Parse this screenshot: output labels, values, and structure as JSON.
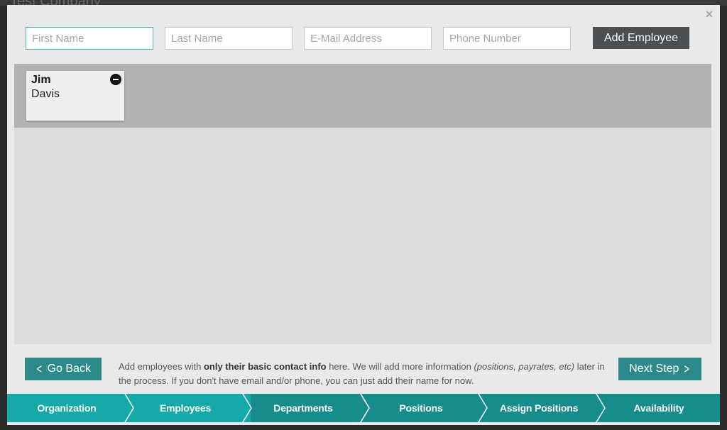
{
  "background": {
    "title": "Test Company"
  },
  "modal": {
    "close_label": "×"
  },
  "form": {
    "first_name_placeholder": "First Name",
    "last_name_placeholder": "Last Name",
    "email_placeholder": "E-Mail Address",
    "phone_placeholder": "Phone Number",
    "add_button_label": "Add Employee"
  },
  "employees": [
    {
      "first": "Jim",
      "last": "Davis"
    }
  ],
  "footer": {
    "back_label": "Go Back",
    "next_label": "Next Step",
    "help_pre": "Add employees with ",
    "help_bold": "only their basic contact info",
    "help_mid": " here. We will add more information ",
    "help_italic": "(positions, payrates, etc)",
    "help_post": " later in the process. If you don't have email and/or phone, you can just add their name for now."
  },
  "steps": [
    {
      "label": "Organization",
      "state": "done"
    },
    {
      "label": "Employees",
      "state": "current"
    },
    {
      "label": "Departments",
      "state": "todo"
    },
    {
      "label": "Positions",
      "state": "todo"
    },
    {
      "label": "Assign Positions",
      "state": "todo"
    },
    {
      "label": "Availability",
      "state": "todo"
    }
  ],
  "colors": {
    "accent_teal": "#16a7a7",
    "dark_teal": "#178c8c",
    "button_dark": "#4b4f52"
  }
}
